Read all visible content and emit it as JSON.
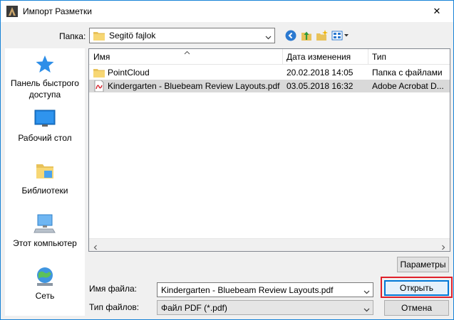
{
  "window": {
    "title": "Импорт Разметки",
    "close_glyph": "✕",
    "border_color": "#1883d7"
  },
  "toolbar": {
    "folder_label": "Папка:",
    "folder_value": "Segitö fajlok",
    "icons": [
      "back-icon",
      "up-folder-icon",
      "new-folder-icon",
      "view-menu-icon"
    ]
  },
  "places": [
    {
      "label": "Панель быстрого доступа",
      "icon": "quick-access-star-icon"
    },
    {
      "label": "Рабочий стол",
      "icon": "desktop-icon"
    },
    {
      "label": "Библиотеки",
      "icon": "libraries-icon"
    },
    {
      "label": "Этот компьютер",
      "icon": "computer-icon"
    },
    {
      "label": "Сеть",
      "icon": "network-icon"
    }
  ],
  "filelist": {
    "columns": [
      "Имя",
      "Дата изменения",
      "Тип"
    ],
    "rows": [
      {
        "name": "PointCloud",
        "date": "20.02.2018 14:05",
        "type": "Папка с файлами",
        "icon": "folder-icon",
        "selected": false
      },
      {
        "name": "Kindergarten - Bluebeam Review Layouts.pdf",
        "date": "03.05.2018 16:32",
        "type": "Adobe Acrobat D...",
        "icon": "pdf-file-icon",
        "selected": true
      }
    ]
  },
  "params_button": "Параметры",
  "filename": {
    "label": "Имя файла:",
    "value": "Kindergarten - Bluebeam Review Layouts.pdf"
  },
  "filetype": {
    "label": "Тип файлов:",
    "value": "Файл PDF (*.pdf)"
  },
  "open_button": "Открыть",
  "cancel_button": "Отмена",
  "colors": {
    "accent": "#0078d7",
    "highlight": "#e0202a",
    "selection": "#d9d9d9"
  }
}
